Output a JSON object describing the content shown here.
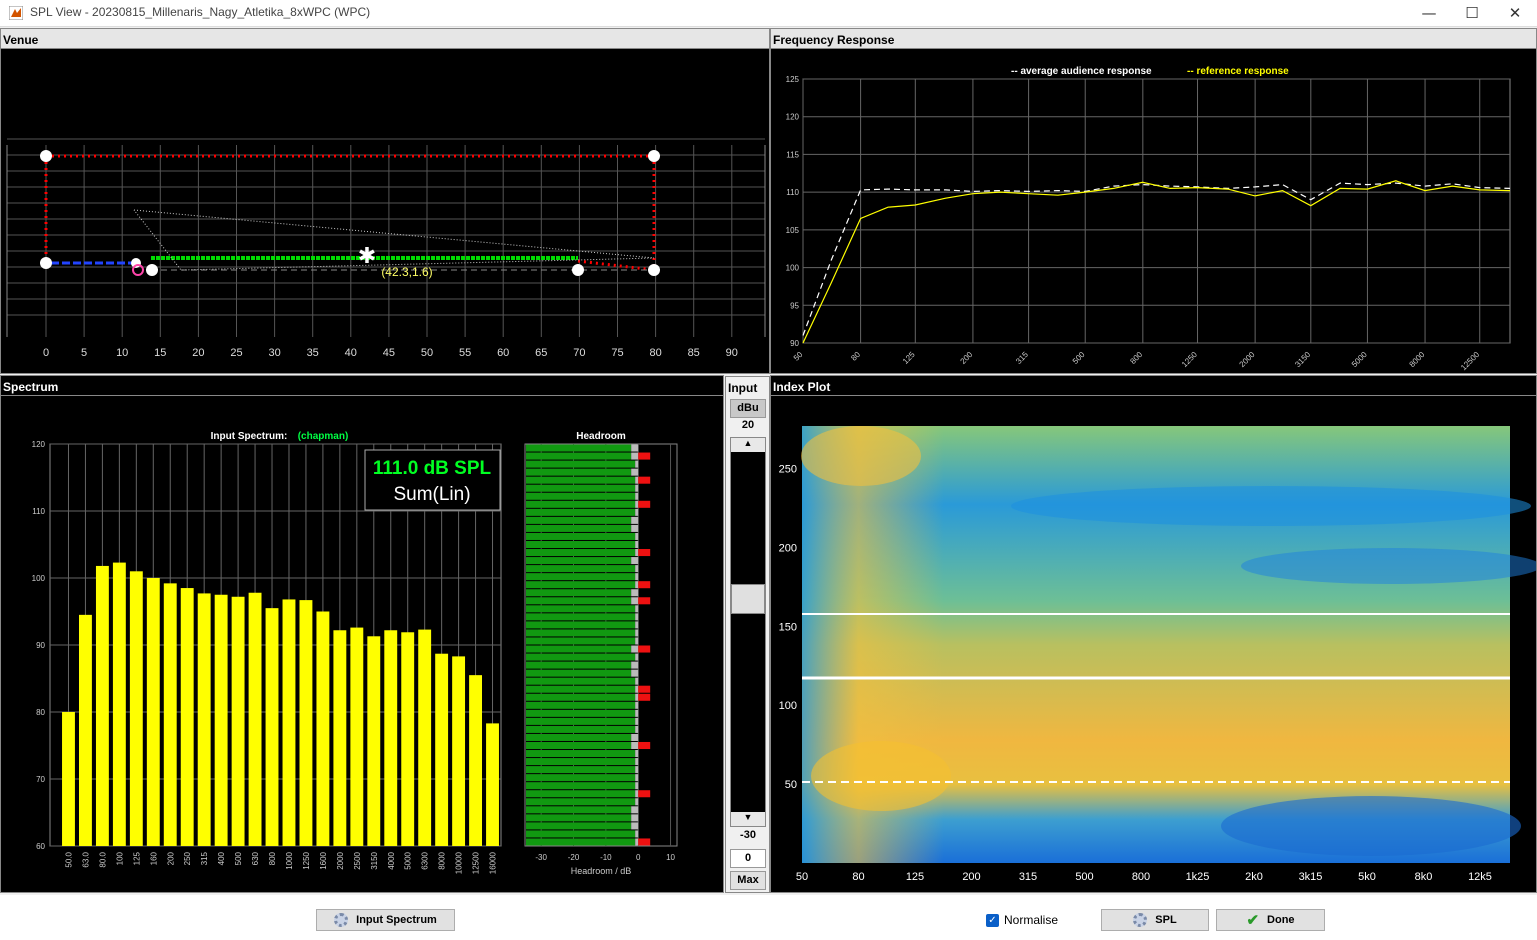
{
  "window": {
    "title": "SPL View - 20230815_Millenaris_Nagy_Atletika_8xWPC (WPC)",
    "icon": "matlab-icon",
    "controls": [
      "minimize-icon",
      "maximize-icon",
      "close-icon"
    ]
  },
  "venue": {
    "title": "Venue",
    "x_ticks": [
      "0",
      "5",
      "10",
      "15",
      "20",
      "25",
      "30",
      "35",
      "40",
      "45",
      "50",
      "55",
      "60",
      "65",
      "70",
      "75",
      "80",
      "85",
      "90"
    ],
    "cursor_label": "(42.3,1.6)"
  },
  "freq": {
    "title": "Frequency Response",
    "legend_avg": "-- average audience response",
    "legend_ref": "-- reference response",
    "y_ticks": [
      "125",
      "120",
      "115",
      "110",
      "105",
      "100",
      "95",
      "90"
    ],
    "x_ticks": [
      "50",
      "80",
      "125",
      "200",
      "315",
      "500",
      "800",
      "1250",
      "2000",
      "3150",
      "5000",
      "8000",
      "12500"
    ],
    "colors": {
      "avg": "#ffffff",
      "ref": "#ffff00"
    }
  },
  "spectrum": {
    "title": "Spectrum",
    "chart_title": "Input Spectrum:",
    "chart_subtitle": "(chapman)",
    "readout_value": "111.0 dB SPL",
    "readout_mode": "Sum(Lin)",
    "y_ticks": [
      "120",
      "110",
      "100",
      "90",
      "80",
      "70",
      "60"
    ],
    "headroom_title": "Headroom",
    "headroom_xlabel": "Headroom / dB",
    "headroom_ticks": [
      "-30",
      "-20",
      "-10",
      "0",
      "10"
    ]
  },
  "input": {
    "title": "Input",
    "unit": "dBu",
    "top_value": "20",
    "bottom_value": "-30",
    "field_value": "0",
    "max_label": "Max"
  },
  "index": {
    "title": "Index Plot",
    "y_ticks": [
      "250",
      "200",
      "150",
      "100",
      "50"
    ],
    "x_ticks": [
      "50",
      "80",
      "125",
      "200",
      "315",
      "500",
      "800",
      "1k25",
      "2k0",
      "3k15",
      "5k0",
      "8k0",
      "12k5"
    ]
  },
  "bottom": {
    "input_spectrum_label": "Input Spectrum",
    "normalise_label": "Normalise",
    "normalise_checked": true,
    "spl_label": "SPL",
    "done_label": "Done"
  },
  "chart_data": [
    {
      "type": "bar",
      "categories": [
        "50.0",
        "63.0",
        "80.0",
        "100",
        "125",
        "160",
        "200",
        "250",
        "315",
        "400",
        "500",
        "630",
        "800",
        "1000",
        "1250",
        "1600",
        "2000",
        "2500",
        "3150",
        "4000",
        "5000",
        "6300",
        "8000",
        "10000",
        "12500",
        "16000"
      ],
      "values": [
        80,
        94.5,
        101.8,
        102.3,
        101,
        100,
        99.2,
        98.5,
        97.7,
        97.5,
        97.2,
        97.8,
        95.5,
        96.8,
        96.7,
        95,
        92.2,
        92.6,
        91.3,
        92.2,
        91.9,
        92.3,
        88.7,
        88.3,
        85.5,
        78.3
      ],
      "title": "Input Spectrum: (chapman)",
      "ylim": [
        60,
        120
      ],
      "color": "#ffff00"
    },
    {
      "type": "line",
      "title": "Frequency Response",
      "x": [
        50,
        63,
        80,
        100,
        125,
        160,
        200,
        250,
        315,
        400,
        500,
        630,
        800,
        1000,
        1250,
        1600,
        2000,
        2500,
        3150,
        4000,
        5000,
        6300,
        8000,
        10000,
        12500,
        16000
      ],
      "series": [
        {
          "name": "average audience response",
          "values": [
            91,
            101,
            110.3,
            110.4,
            110.3,
            110.3,
            110.1,
            110.2,
            110.1,
            110.2,
            110.1,
            110.8,
            111,
            110.8,
            110.7,
            110.5,
            110.7,
            111,
            109,
            111.2,
            111,
            111.2,
            110.8,
            111.1,
            110.6,
            110.5
          ]
        },
        {
          "name": "reference response",
          "values": [
            90,
            98,
            106.5,
            108,
            108.3,
            109.2,
            109.8,
            110,
            109.8,
            109.6,
            110,
            110.5,
            111.3,
            110.5,
            110.6,
            110.4,
            109.5,
            110.2,
            108.2,
            110.5,
            110.4,
            111.5,
            110.2,
            110.8,
            110.3,
            110.2
          ]
        }
      ],
      "ylim": [
        90,
        125
      ],
      "grid": true,
      "legend": "top"
    }
  ]
}
